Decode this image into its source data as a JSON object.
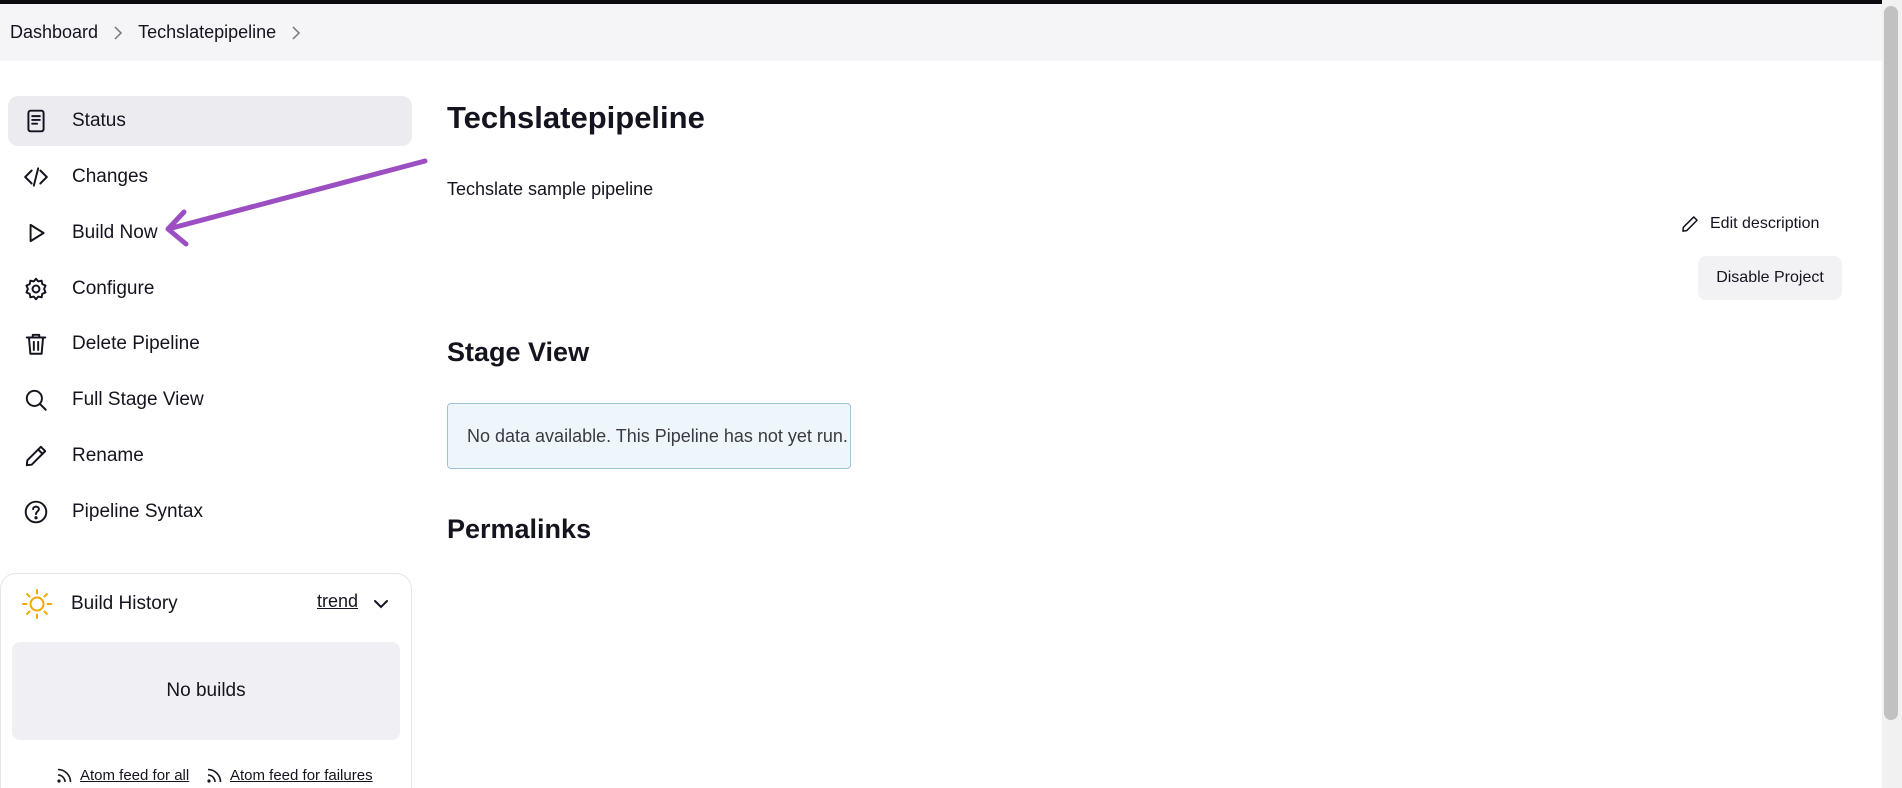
{
  "breadcrumb": [
    "Dashboard",
    "Techslatepipeline"
  ],
  "sidebar": {
    "tasks": [
      {
        "label": "Status",
        "icon": "document-icon",
        "active": true
      },
      {
        "label": "Changes",
        "icon": "code-icon"
      },
      {
        "label": "Build Now",
        "icon": "play-icon"
      },
      {
        "label": "Configure",
        "icon": "gear-icon"
      },
      {
        "label": "Delete Pipeline",
        "icon": "trash-icon"
      },
      {
        "label": "Full Stage View",
        "icon": "search-icon"
      },
      {
        "label": "Rename",
        "icon": "pencil-icon"
      },
      {
        "label": "Pipeline Syntax",
        "icon": "help-icon"
      }
    ]
  },
  "build_history": {
    "title": "Build History",
    "trend_label": "trend",
    "empty_label": "No builds",
    "feed_all": "Atom feed for all",
    "feed_failures": "Atom feed for failures",
    "icon": "sun-icon"
  },
  "main": {
    "title": "Techslatepipeline",
    "description": "Techslate sample pipeline",
    "edit_description": "Edit description",
    "disable_project": "Disable Project",
    "stage_view_title": "Stage View",
    "stage_view_empty": "No data available. This Pipeline has not yet run.",
    "permalinks_title": "Permalinks"
  },
  "colors": {
    "annotation_arrow": "#9b4fc2",
    "active_item_bg": "#ebebf0",
    "info_box_bg": "#eef6fb",
    "info_box_border": "#9cc4dc",
    "sun": "#f2a900"
  }
}
